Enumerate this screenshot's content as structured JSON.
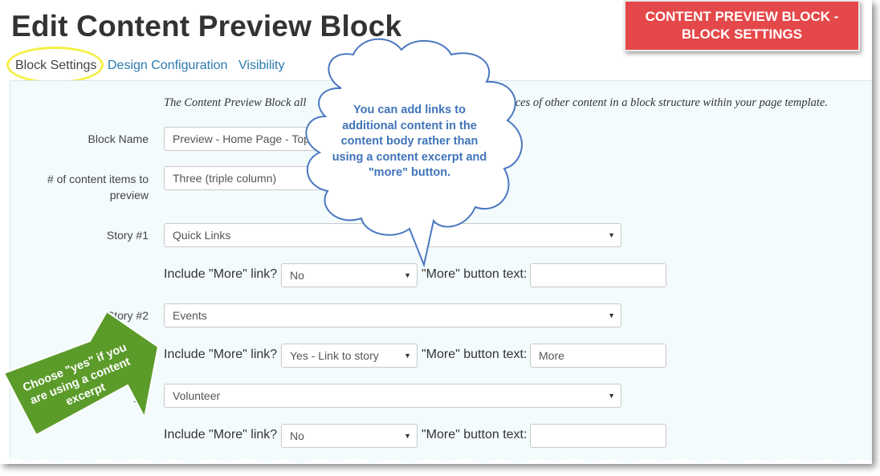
{
  "page": {
    "title": "Edit Content Preview Block"
  },
  "tabs": [
    {
      "label": "Block Settings"
    },
    {
      "label": "Design Configuration"
    },
    {
      "label": "Visibility"
    }
  ],
  "intro": {
    "start": "The Content Preview Block all",
    "end": "pieces of other content in a block structure within your page template."
  },
  "form": {
    "block_name": {
      "label": "Block Name",
      "value": "Preview - Home Page - Top"
    },
    "content_items": {
      "label": "# of content items to preview",
      "value": "Three (triple column)"
    },
    "story1": {
      "label": "Story #1",
      "value": "Quick Links",
      "more_link_label": "Include \"More\" link?",
      "more_link_value": "No",
      "button_text_label": "\"More\" button text:",
      "button_text_value": ""
    },
    "story2": {
      "label": "Story #2",
      "value": "Events",
      "more_link_label": "Include \"More\" link?",
      "more_link_value": "Yes - Link to story",
      "button_text_label": "\"More\" button text:",
      "button_text_value": "More"
    },
    "story3": {
      "label": "y #",
      "value": "Volunteer",
      "more_link_label": "Include \"More\" link?",
      "more_link_value": "No",
      "button_text_label": "\"More\" button text:",
      "button_text_value": ""
    }
  },
  "annotations": {
    "banner": "CONTENT PREVIEW BLOCK - BLOCK SETTINGS",
    "cloud": "You can add links to additional content in the content body rather than using a content excerpt and \"more\" button.",
    "arrow": "Choose \"yes\" if you are using a content excerpt"
  },
  "colors": {
    "link": "#2a7ab0",
    "panel_bg": "#f3fbfd",
    "banner_bg": "#e5484a",
    "highlight": "#f5ef45",
    "cloud_border": "#4b78c0",
    "cloud_text": "#3f74b8",
    "arrow_fill": "#5b9b2a"
  },
  "icons": {
    "select_arrow": "▼"
  }
}
